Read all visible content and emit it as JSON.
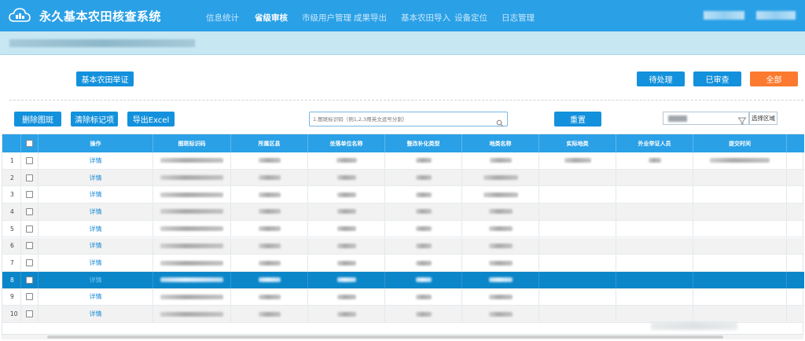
{
  "header": {
    "app_title": "永久基本农田核查系统",
    "nav": [
      {
        "label": "信息统计",
        "active": false
      },
      {
        "label": "省级审核",
        "active": true
      },
      {
        "label": "市级用户管理",
        "active": false
      },
      {
        "label": "成果导出",
        "active": false
      },
      {
        "label": "基本农田导入",
        "active": false
      },
      {
        "label": "设备定位",
        "active": false
      },
      {
        "label": "日志管理",
        "active": false
      }
    ]
  },
  "toolbar": {
    "evidence_button": "基本农田举证",
    "filter_pending": "待处理",
    "filter_reviewed": "已审查",
    "filter_all": "全部",
    "delete_spots": "删除图斑",
    "clear_marks": "清除标记项",
    "export_excel": "导出Excel",
    "search_placeholder": "1.图斑标识码（例1,2,3用英文逗号分割）",
    "reset": "重置",
    "region_button": "选择区域"
  },
  "table": {
    "columns": [
      "操作",
      "图斑标识码",
      "所属区县",
      "坐落单位名称",
      "整改补化类型",
      "地类名称",
      "实际地类",
      "外业举证人员",
      "提交时间"
    ],
    "rows": [
      {
        "num": "1",
        "action": "详情",
        "selected": false
      },
      {
        "num": "2",
        "action": "详情",
        "selected": false
      },
      {
        "num": "3",
        "action": "详情",
        "selected": false
      },
      {
        "num": "4",
        "action": "详情",
        "selected": false
      },
      {
        "num": "5",
        "action": "详情",
        "selected": false
      },
      {
        "num": "6",
        "action": "详情",
        "selected": false
      },
      {
        "num": "7",
        "action": "详情",
        "selected": false
      },
      {
        "num": "8",
        "action": "详情",
        "selected": true
      },
      {
        "num": "9",
        "action": "详情",
        "selected": false
      },
      {
        "num": "10",
        "action": "详情",
        "selected": false
      }
    ]
  },
  "colors": {
    "header_bg": "#2aa0e6",
    "button_blue": "#1391dc",
    "button_orange": "#fb7a2f",
    "selected_row": "#0b86c9"
  }
}
